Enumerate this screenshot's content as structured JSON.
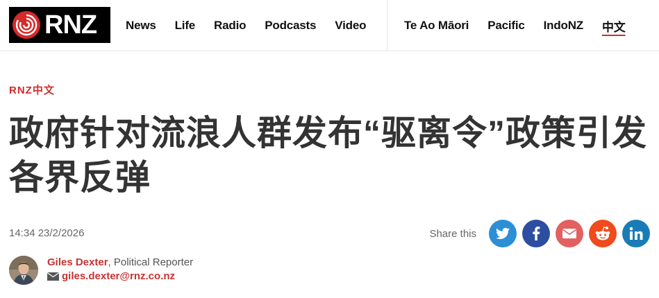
{
  "brand": {
    "logo_text": "RNZ"
  },
  "nav": {
    "main": [
      "News",
      "Life",
      "Radio",
      "Podcasts",
      "Video"
    ],
    "secondary": [
      "Te Ao Māori",
      "Pacific",
      "IndoNZ",
      "中文"
    ],
    "current": "中文"
  },
  "article": {
    "section": "RNZ中文",
    "headline": "政府针对流浪人群发布“驱离令”政策引发各界反弹",
    "timestamp": "14:34 23/2/2026"
  },
  "share": {
    "label": "Share this",
    "buttons": [
      {
        "name": "twitter",
        "color": "#2b8fd6"
      },
      {
        "name": "facebook",
        "color": "#2d4ea0"
      },
      {
        "name": "email",
        "color": "#e26060"
      },
      {
        "name": "reddit",
        "color": "#f04a1d"
      },
      {
        "name": "linkedin",
        "color": "#1a7cb6"
      }
    ]
  },
  "author": {
    "name": "Giles Dexter",
    "role": ", Political Reporter",
    "email": "giles.dexter@rnz.co.nz"
  },
  "colors": {
    "accent": "#d42a2a",
    "headline": "#333333"
  }
}
